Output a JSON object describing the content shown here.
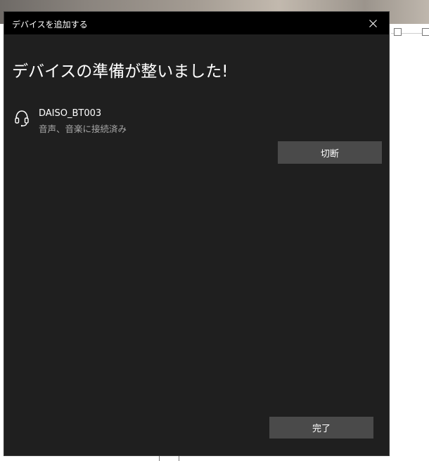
{
  "dialog": {
    "title": "デバイスを追加する",
    "heading": "デバイスの準備が整いました!",
    "close_icon": "close-icon"
  },
  "device": {
    "icon": "headset-icon",
    "name": "DAISO_BT003",
    "status": "音声、音楽に接続済み"
  },
  "buttons": {
    "disconnect_label": "切断",
    "done_label": "完了"
  },
  "colors": {
    "dialog_background": "#1f1f1f",
    "titlebar_background": "#000000",
    "button_background": "#4a4a4a",
    "primary_text": "#ffffff",
    "secondary_text": "#a8a8a8"
  }
}
